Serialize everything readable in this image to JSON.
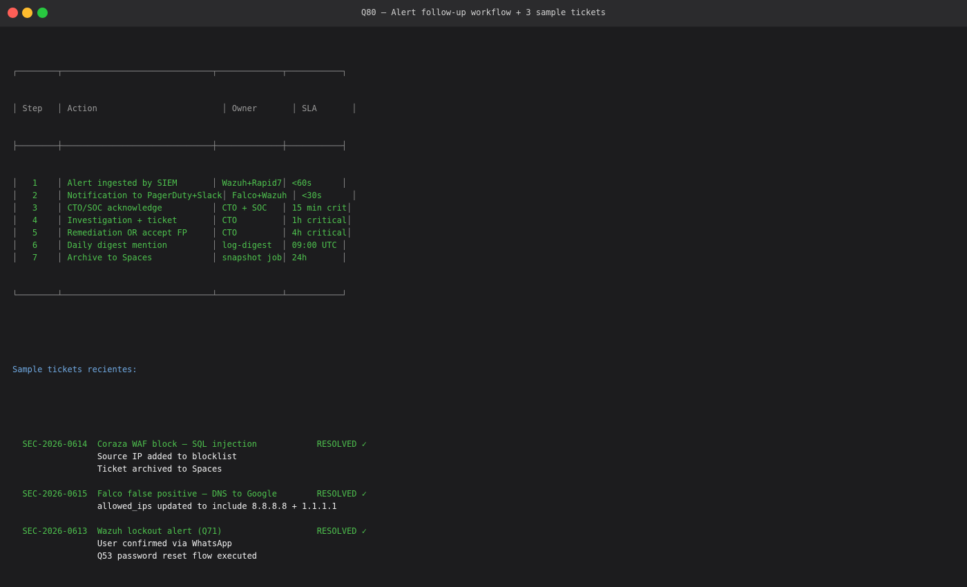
{
  "window": {
    "title": "Q80 — Alert follow-up workflow + 3 sample tickets"
  },
  "table": {
    "headers": [
      "Step",
      "Action",
      "Owner",
      "SLA"
    ],
    "rows": [
      {
        "step": "1",
        "action": "Alert ingested by SIEM",
        "owner": "Wazuh+Rapid7",
        "sla": "<60s"
      },
      {
        "step": "2",
        "action": "Notification to PagerDuty+Slack",
        "owner": "Falco+Wazuh",
        "sla": "<30s"
      },
      {
        "step": "3",
        "action": "CTO/SOC acknowledge",
        "owner": "CTO + SOC",
        "sla": "15 min crit"
      },
      {
        "step": "4",
        "action": "Investigation + ticket",
        "owner": "CTO",
        "sla": "1h critical"
      },
      {
        "step": "5",
        "action": "Remediation OR accept FP",
        "owner": "CTO",
        "sla": "4h critical"
      },
      {
        "step": "6",
        "action": "Daily digest mention",
        "owner": "log-digest",
        "sla": "09:00 UTC"
      },
      {
        "step": "7",
        "action": "Archive to Spaces",
        "owner": "snapshot job",
        "sla": "24h"
      }
    ]
  },
  "tickets_heading": "Sample tickets recientes:",
  "tickets": [
    {
      "id": "SEC-2026-0614",
      "title": "Coraza WAF block — SQL injection",
      "status": "RESOLVED ✓",
      "notes": [
        "Source IP added to blocklist",
        "Ticket archived to Spaces"
      ]
    },
    {
      "id": "SEC-2026-0615",
      "title": "Falco false positive — DNS to Google",
      "status": "RESOLVED ✓",
      "notes": [
        "allowed_ips updated to include 8.8.8.8 + 1.1.1.1"
      ]
    },
    {
      "id": "SEC-2026-0613",
      "title": "Wazuh lockout alert (Q71)",
      "status": "RESOLVED ✓",
      "notes": [
        "User confirmed via WhatsApp",
        "Q53 password reset flow executed"
      ]
    }
  ]
}
